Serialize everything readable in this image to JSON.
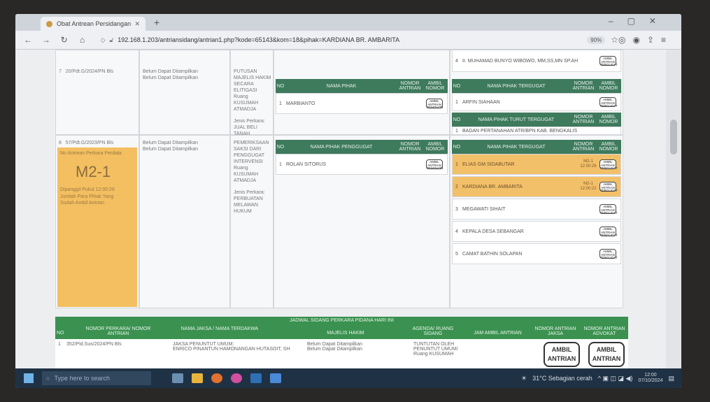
{
  "browser": {
    "tab_title": "Obat Antrean Persidangan",
    "url": "192.168.1.203/antriansidang/antrian1.php?kode=65143&kom=18&pihak=KARDIANA BR. AMBARITA",
    "zoom": "90%"
  },
  "case_top": {
    "no": "7",
    "number": "20/Pdt.G/2024/PN Bls",
    "jaksa": [
      "Belum Dapat Ditampilkan",
      "Belum Dapat Ditampilkan"
    ],
    "agenda": "PUTUSAN MAJELIS HAKIM SECARA ELITIGASI Ruang KUSUMAH ATMADJA",
    "jenis": "Jenis Perkara: JUAL BELI TANAH",
    "pihak_header": [
      "NO",
      "NAMA PIHAK",
      "NOMOR ANTRIAN",
      "AMBIL NOMOR"
    ],
    "pihak_rows": [
      {
        "no": "1",
        "name": "MARBIANTO"
      }
    ],
    "tergugat_header": [
      "NO",
      "NAMA PIHAK TERGUGAT",
      "NOMOR ANTRIAN",
      "AMBIL NOMOR"
    ],
    "tergugat_top_row": {
      "no": "4",
      "name": "Ir. MUHAMAD BUNYO WIBOWO, MM,SS,MN SP.AH"
    },
    "tergugat_rows": [
      {
        "no": "1",
        "name": "ARFIN SIAHAAN"
      }
    ],
    "turut_header": [
      "NO",
      "NAMA PIHAK TURUT TERGUGAT",
      "NOMOR ANTRIAN",
      "AMBIL NOMOR"
    ],
    "turut_rows": [
      {
        "no": "1",
        "name": "BADAN PERTANAHAN ATR/BPN KAB. BENGKALIS"
      }
    ]
  },
  "case_main": {
    "no": "8",
    "number": "57/Pdt.G/2023/PN Bls",
    "queue_label": "No Antrean Perkara Perdata",
    "queue_number": "M2-1",
    "called_note": "Dipanggil Pukul 12:00:26",
    "sub_note": "Jumlah Para Pihak Yang Sudah Ambil Antrian",
    "jaksa": [
      "Belum Dapat Ditampilkan",
      "Belum Dapat Ditampilkan"
    ],
    "agenda": "PEMERIKSAAN SAKSI DARI PENGGUGAT INTERVENSI Ruang KUSUMAH ATMADJA",
    "jenis": "Jenis Perkara: PERBUATAN MELAWAN HUKUM",
    "penggugat_header": [
      "NO",
      "NAMA PIHAK PENGGUGAT",
      "NOMOR ANTRIAN",
      "AMBIL NOMOR"
    ],
    "penggugat_rows": [
      {
        "no": "1",
        "name": "ROLAN SITORUS"
      }
    ],
    "tergugat_header": [
      "NO",
      "NAMA PIHAK TERGUGAT",
      "NOMOR ANTRIAN",
      "AMBIL NOMOR"
    ],
    "tergugat_rows": [
      {
        "no": "1",
        "name": "ELIAS GM SIDABUTAR",
        "queue": "M2-1",
        "time": "12:00:26",
        "highlight": true
      },
      {
        "no": "2",
        "name": "KARDIANA BR. AMBARITA",
        "queue": "M2-1",
        "time": "12:00:22",
        "highlight": true
      },
      {
        "no": "3",
        "name": "MEGAWATI SIHAIT",
        "queue": "",
        "time": "",
        "highlight": false
      },
      {
        "no": "4",
        "name": "KEPALA DESA SEBANGAR",
        "queue": "",
        "time": "",
        "highlight": false
      },
      {
        "no": "5",
        "name": "CAMAT BATHIN SOLAPAN",
        "queue": "",
        "time": "",
        "highlight": false
      }
    ],
    "ambil_label": [
      "AMBIL",
      "ANTRIAN",
      "TERGUGAT"
    ]
  },
  "schedule": {
    "title": "JADWAL SIDANG PERKARA PIDANA HARI INI",
    "headers": [
      "NO",
      "NOMOR PERKARA/ NOMOR ANTRIAN",
      "NAMA JAKSA / NAMA TERDAKWA",
      "MAJELIS HAKIM",
      "AGENDA/ RUANG SIDANG",
      "JAM AMBIL ANTRIAN",
      "NOMOR ANTRIAN JAKSA",
      "NOMOR ANTRIAN ADVOKAT"
    ],
    "row": {
      "no": "1",
      "number": "352/Pid.Sus/2024/PN Bls",
      "jaksa": "JAKSA PENUNTUT UMUM:",
      "terdakwa": "ENRICO PINANTUN HAMONANGAN HUTASOIT, SH",
      "hakim1": "Belum Dapat Ditampilkan",
      "hakim2": "Belum Dapat Ditampilkan",
      "agenda": "TUNTUTAN OLEH PENUNTUT UMUM/ Ruang KUSUMAH",
      "btn1": [
        "AMBIL",
        "ANTRIAN"
      ],
      "btn2": [
        "AMBIL",
        "ANTRIAN"
      ]
    }
  },
  "taskbar": {
    "search_placeholder": "Type here to search",
    "weather": "31°C Sebagian cerah",
    "time": "12:00",
    "date": "07/10/2024"
  }
}
